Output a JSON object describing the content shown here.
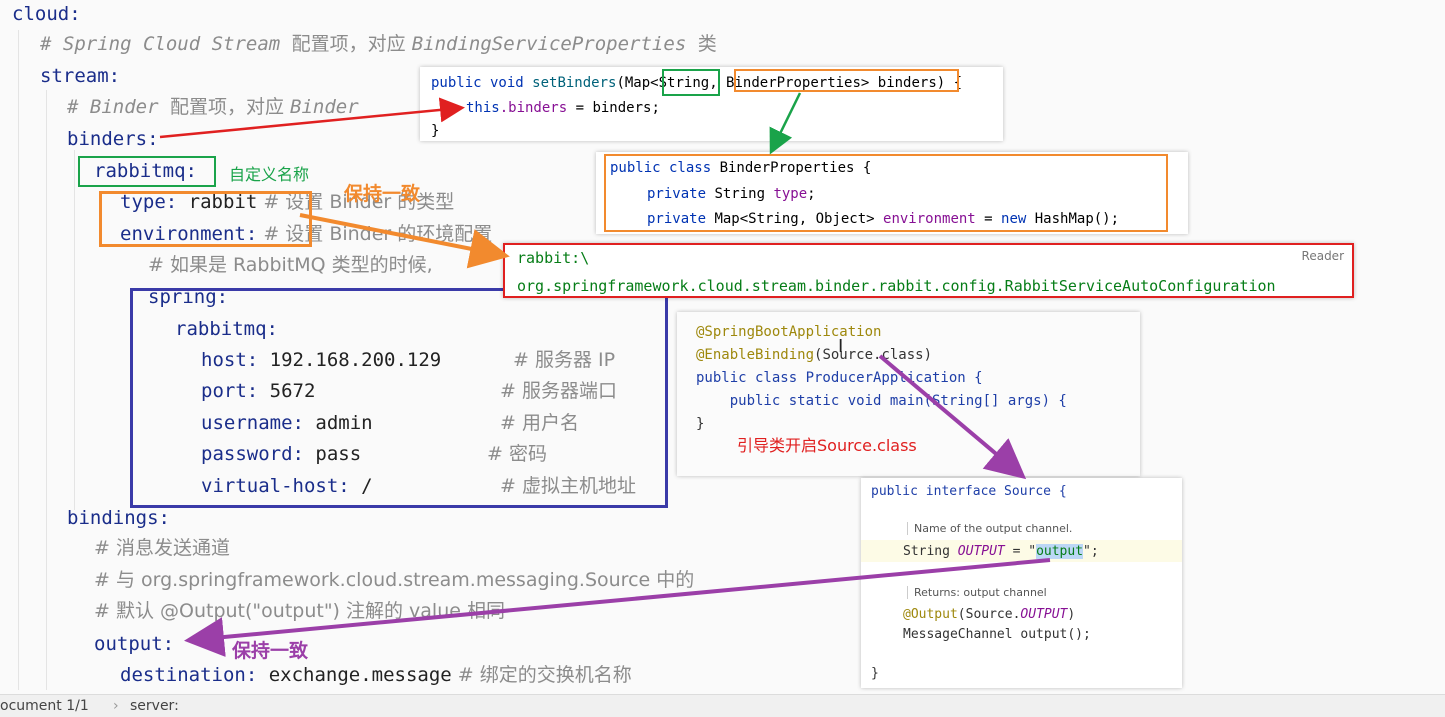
{
  "yaml": {
    "l1": "cloud:",
    "l2_comment": "# Spring Cloud Stream ",
    "l2_cn": "配置项，对应 ",
    "l2_class": "BindingServiceProperties ",
    "l2_tail": "类",
    "l3": "stream:",
    "l4_comment": "# Binder ",
    "l4_cn": "配置项，对应 ",
    "l4_class": "Binder",
    "l5": "binders:",
    "l6": "rabbitmq:",
    "l7_key": "type:",
    "l7_val": " rabbit",
    "l7_comment": " # 设置 Binder 的类型",
    "l8_key": "environment:",
    "l8_comment": " # 设置 Binder 的环境配置",
    "l9_comment": "# 如果是 RabbitMQ 类型的时候,",
    "l10": "spring:",
    "l11": "rabbitmq:",
    "host_key": "host:",
    "host_val": " 192.168.200.129",
    "host_comment": "# 服务器 IP",
    "port_key": "port:",
    "port_val": " 5672",
    "port_comment": "# 服务器端口",
    "user_key": "username:",
    "user_val": " admin",
    "user_comment": "# 用户名",
    "pass_key": "password:",
    "pass_val": " pass",
    "pass_comment": "# 密码",
    "vh_key": "virtual-host:",
    "vh_val": " /",
    "vh_comment": "# 虚拟主机地址",
    "l17": "bindings:",
    "l18_comment": "# 消息发送通道",
    "l19_comment": "# 与 org.springframework.cloud.stream.messaging.Source 中的",
    "l20_comment": "# 默认 @Output(\"output\") 注解的 value 相同",
    "l21": "output:",
    "l22_key": "destination:",
    "l22_val": " exchange.message",
    "l22_comment": " # 绑定的交换机名称"
  },
  "annotations": {
    "custom_name": "自定义名称",
    "keep_consistent_1": "保持一致",
    "keep_consistent_2": "保持一致",
    "bootstrap_note": "引导类开启Source.class"
  },
  "panel_setbinders": {
    "l1a": "public void ",
    "l1b": "setBinders",
    "l1c": "(Map<",
    "l1d": "String",
    "l1e": ", ",
    "l1f": "BinderProperties> binders)",
    "l1g": " {",
    "l2a": "this",
    "l2b": ".binders",
    "l2c": " = binders;",
    "l3": "}"
  },
  "panel_binderprops": {
    "l1a": "public class ",
    "l1b": "BinderProperties {",
    "l2a": "private ",
    "l2b": "String ",
    "l2c": "type",
    "l2d": ";",
    "l3a": "private ",
    "l3b": "Map<String, Object> ",
    "l3c": "environment",
    "l3d": " = ",
    "l3e": "new ",
    "l3f": "HashMap();"
  },
  "panel_factories": {
    "l1": "rabbit:\\",
    "reader": "Reader",
    "l2": "org.springframework.cloud.stream.binder.rabbit.config.RabbitServiceAutoConfiguration"
  },
  "panel_app": {
    "l1": "@SpringBootApplication",
    "l2a": "@EnableBinding",
    "l2b": "(Source.class)",
    "l3": "public class ProducerApplication {",
    "l4": "    public static void main(String[] args) {",
    "l5": "}"
  },
  "panel_source": {
    "l1": "public interface Source {",
    "doc1": "Name of the output channel.",
    "l2a": "String ",
    "l2b": "OUTPUT",
    "l2c": " = \"",
    "l2d": "output",
    "l2e": "\";",
    "doc2": "Returns: output channel",
    "l3a": "@Output",
    "l3b": "(Source.",
    "l3c": "OUTPUT",
    "l3d": ")",
    "l4": "MessageChannel output();",
    "l5": "}"
  },
  "statusbar": {
    "doc": "ocument 1/1",
    "sep": "›",
    "path": "server:"
  },
  "colors": {
    "red": "#e02020",
    "green": "#1aa34a",
    "orange": "#f28a2e",
    "navy": "#3a3aa8",
    "purple": "#9b3fa8",
    "highlight": "#bcd7f5"
  }
}
